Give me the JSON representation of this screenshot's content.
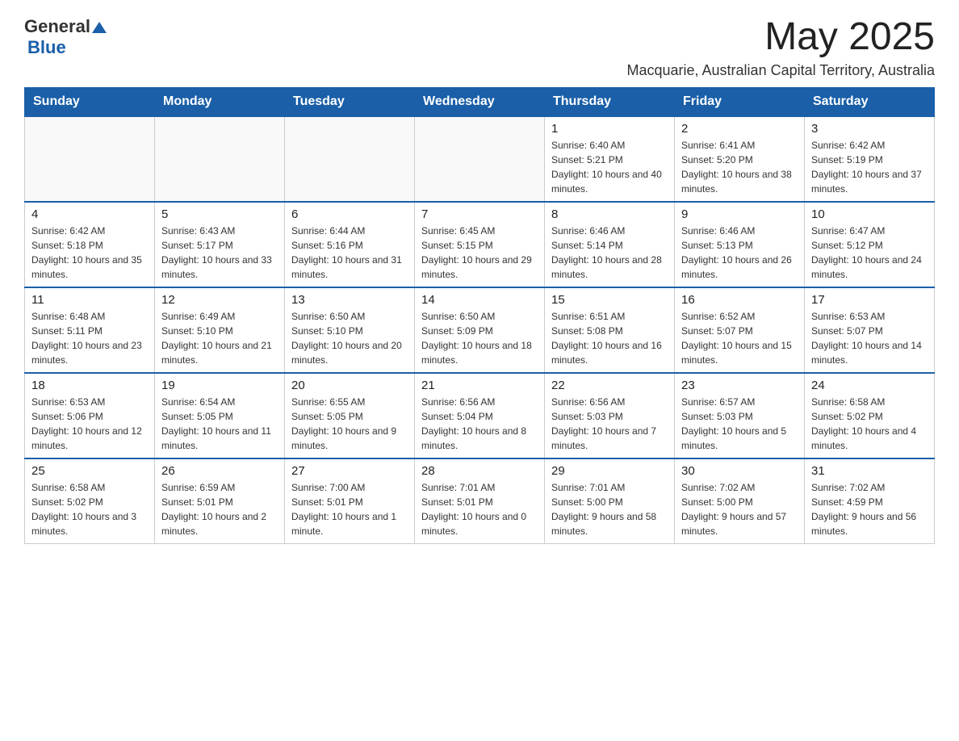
{
  "header": {
    "logo_general": "General",
    "logo_blue": "Blue",
    "month_year": "May 2025",
    "location": "Macquarie, Australian Capital Territory, Australia"
  },
  "days_of_week": [
    "Sunday",
    "Monday",
    "Tuesday",
    "Wednesday",
    "Thursday",
    "Friday",
    "Saturday"
  ],
  "weeks": [
    {
      "days": [
        {
          "number": "",
          "info": ""
        },
        {
          "number": "",
          "info": ""
        },
        {
          "number": "",
          "info": ""
        },
        {
          "number": "",
          "info": ""
        },
        {
          "number": "1",
          "info": "Sunrise: 6:40 AM\nSunset: 5:21 PM\nDaylight: 10 hours and 40 minutes."
        },
        {
          "number": "2",
          "info": "Sunrise: 6:41 AM\nSunset: 5:20 PM\nDaylight: 10 hours and 38 minutes."
        },
        {
          "number": "3",
          "info": "Sunrise: 6:42 AM\nSunset: 5:19 PM\nDaylight: 10 hours and 37 minutes."
        }
      ]
    },
    {
      "days": [
        {
          "number": "4",
          "info": "Sunrise: 6:42 AM\nSunset: 5:18 PM\nDaylight: 10 hours and 35 minutes."
        },
        {
          "number": "5",
          "info": "Sunrise: 6:43 AM\nSunset: 5:17 PM\nDaylight: 10 hours and 33 minutes."
        },
        {
          "number": "6",
          "info": "Sunrise: 6:44 AM\nSunset: 5:16 PM\nDaylight: 10 hours and 31 minutes."
        },
        {
          "number": "7",
          "info": "Sunrise: 6:45 AM\nSunset: 5:15 PM\nDaylight: 10 hours and 29 minutes."
        },
        {
          "number": "8",
          "info": "Sunrise: 6:46 AM\nSunset: 5:14 PM\nDaylight: 10 hours and 28 minutes."
        },
        {
          "number": "9",
          "info": "Sunrise: 6:46 AM\nSunset: 5:13 PM\nDaylight: 10 hours and 26 minutes."
        },
        {
          "number": "10",
          "info": "Sunrise: 6:47 AM\nSunset: 5:12 PM\nDaylight: 10 hours and 24 minutes."
        }
      ]
    },
    {
      "days": [
        {
          "number": "11",
          "info": "Sunrise: 6:48 AM\nSunset: 5:11 PM\nDaylight: 10 hours and 23 minutes."
        },
        {
          "number": "12",
          "info": "Sunrise: 6:49 AM\nSunset: 5:10 PM\nDaylight: 10 hours and 21 minutes."
        },
        {
          "number": "13",
          "info": "Sunrise: 6:50 AM\nSunset: 5:10 PM\nDaylight: 10 hours and 20 minutes."
        },
        {
          "number": "14",
          "info": "Sunrise: 6:50 AM\nSunset: 5:09 PM\nDaylight: 10 hours and 18 minutes."
        },
        {
          "number": "15",
          "info": "Sunrise: 6:51 AM\nSunset: 5:08 PM\nDaylight: 10 hours and 16 minutes."
        },
        {
          "number": "16",
          "info": "Sunrise: 6:52 AM\nSunset: 5:07 PM\nDaylight: 10 hours and 15 minutes."
        },
        {
          "number": "17",
          "info": "Sunrise: 6:53 AM\nSunset: 5:07 PM\nDaylight: 10 hours and 14 minutes."
        }
      ]
    },
    {
      "days": [
        {
          "number": "18",
          "info": "Sunrise: 6:53 AM\nSunset: 5:06 PM\nDaylight: 10 hours and 12 minutes."
        },
        {
          "number": "19",
          "info": "Sunrise: 6:54 AM\nSunset: 5:05 PM\nDaylight: 10 hours and 11 minutes."
        },
        {
          "number": "20",
          "info": "Sunrise: 6:55 AM\nSunset: 5:05 PM\nDaylight: 10 hours and 9 minutes."
        },
        {
          "number": "21",
          "info": "Sunrise: 6:56 AM\nSunset: 5:04 PM\nDaylight: 10 hours and 8 minutes."
        },
        {
          "number": "22",
          "info": "Sunrise: 6:56 AM\nSunset: 5:03 PM\nDaylight: 10 hours and 7 minutes."
        },
        {
          "number": "23",
          "info": "Sunrise: 6:57 AM\nSunset: 5:03 PM\nDaylight: 10 hours and 5 minutes."
        },
        {
          "number": "24",
          "info": "Sunrise: 6:58 AM\nSunset: 5:02 PM\nDaylight: 10 hours and 4 minutes."
        }
      ]
    },
    {
      "days": [
        {
          "number": "25",
          "info": "Sunrise: 6:58 AM\nSunset: 5:02 PM\nDaylight: 10 hours and 3 minutes."
        },
        {
          "number": "26",
          "info": "Sunrise: 6:59 AM\nSunset: 5:01 PM\nDaylight: 10 hours and 2 minutes."
        },
        {
          "number": "27",
          "info": "Sunrise: 7:00 AM\nSunset: 5:01 PM\nDaylight: 10 hours and 1 minute."
        },
        {
          "number": "28",
          "info": "Sunrise: 7:01 AM\nSunset: 5:01 PM\nDaylight: 10 hours and 0 minutes."
        },
        {
          "number": "29",
          "info": "Sunrise: 7:01 AM\nSunset: 5:00 PM\nDaylight: 9 hours and 58 minutes."
        },
        {
          "number": "30",
          "info": "Sunrise: 7:02 AM\nSunset: 5:00 PM\nDaylight: 9 hours and 57 minutes."
        },
        {
          "number": "31",
          "info": "Sunrise: 7:02 AM\nSunset: 4:59 PM\nDaylight: 9 hours and 56 minutes."
        }
      ]
    }
  ]
}
